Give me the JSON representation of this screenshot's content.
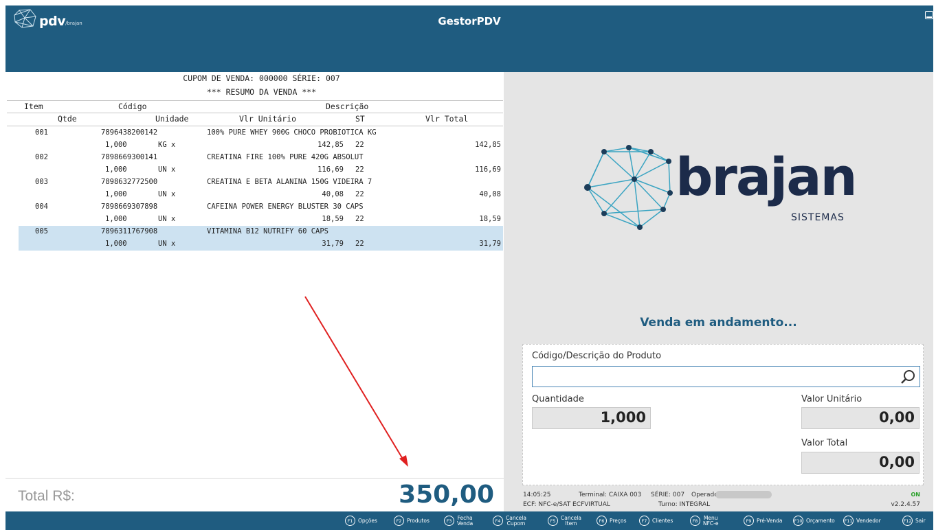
{
  "app": {
    "title": "GestorPDV",
    "logo_text": "pdv",
    "logo_sub": "/brajan"
  },
  "receipt": {
    "title": "CUPOM DE VENDA: 000000  SÉRIE: 007",
    "subtitle": "*** RESUMO DA VENDA ***",
    "headers": {
      "item": "Item",
      "codigo": "Código",
      "descricao": "Descrição",
      "qtde": "Qtde",
      "unidade": "Unidade",
      "vlr_unitario": "Vlr Unitário",
      "st": "ST",
      "vlr_total": "Vlr Total"
    },
    "items": [
      {
        "item": "001",
        "codigo": "7896438200142",
        "descricao": "100% PURE WHEY 900G CHOCO PROBIOTICA KG",
        "qtde": "1,000",
        "unidade": "KG x",
        "vlr_unitario": "142,85",
        "st": "22",
        "vlr_total": "142,85",
        "selected": false
      },
      {
        "item": "002",
        "codigo": "7898669300141",
        "descricao": "CREATINA FIRE 100% PURE 420G ABSOLUT",
        "qtde": "1,000",
        "unidade": "UN x",
        "vlr_unitario": "116,69",
        "st": "22",
        "vlr_total": "116,69",
        "selected": false
      },
      {
        "item": "003",
        "codigo": "7898632772500",
        "descricao": "CREATINA E BETA ALANINA 150G VIDEIRA 7",
        "qtde": "1,000",
        "unidade": "UN x",
        "vlr_unitario": "40,08",
        "st": "22",
        "vlr_total": "40,08",
        "selected": false
      },
      {
        "item": "004",
        "codigo": "7898669307898",
        "descricao": "CAFEINA POWER ENERGY BLUSTER 30 CAPS",
        "qtde": "1,000",
        "unidade": "UN x",
        "vlr_unitario": "18,59",
        "st": "22",
        "vlr_total": "18,59",
        "selected": false
      },
      {
        "item": "005",
        "codigo": "7896311767908",
        "descricao": "VITAMINA B12 NUTRIFY 60 CAPS",
        "qtde": "1,000",
        "unidade": "UN x",
        "vlr_unitario": "31,79",
        "st": "22",
        "vlr_total": "31,79",
        "selected": true
      }
    ],
    "selected_color": "#cde2f1"
  },
  "total": {
    "label": "Total R$:",
    "value": "350,00"
  },
  "brand": {
    "name": "brajan",
    "tagline": "SISTEMAS",
    "color": "#1c2b4a",
    "accent": "#3aa4c2"
  },
  "sale": {
    "status": "Venda em andamento...",
    "search_label": "Código/Descrição do Produto",
    "search_value": "",
    "search_icon": "magnifier-icon",
    "qty_label": "Quantidade",
    "qty_value": "1,000",
    "unit_label": "Valor Unitário",
    "unit_value": "0,00",
    "total_label": "Valor Total",
    "total_value": "0,00"
  },
  "info": {
    "time": "14:05:25",
    "terminal": "Terminal: CAIXA 003",
    "serie": "SÉRIE: 007",
    "operador": "Operador:",
    "ecf": "ECF: NFC-e/SAT ECFVIRTUAL",
    "turno": "Turno: INTEGRAL",
    "online": "ON",
    "version": "v2.2.4.57"
  },
  "fkeys": [
    {
      "key": "F1",
      "label": "Opções"
    },
    {
      "key": "F2",
      "label": "Produtos"
    },
    {
      "key": "F3",
      "label": "Fecha",
      "label2": "Venda"
    },
    {
      "key": "F4",
      "label": "Cancela",
      "label2": "Cupom"
    },
    {
      "key": "F5",
      "label": "Cancela",
      "label2": "Item"
    },
    {
      "key": "F6",
      "label": "Preços"
    },
    {
      "key": "F7",
      "label": "Clientes"
    },
    {
      "key": "F8",
      "label": "Menu",
      "label2": "NFC-e"
    },
    {
      "key": "F9",
      "label": "Pré-Venda"
    },
    {
      "key": "F10",
      "label": "Orçamento"
    },
    {
      "key": "F11",
      "label": "Vendedor"
    },
    {
      "key": "F12",
      "label": "Sair"
    }
  ],
  "colors": {
    "primary": "#1f5c80",
    "arrow": "#e02020",
    "panel": "#e5e5e5",
    "online": "#2aa12a"
  }
}
